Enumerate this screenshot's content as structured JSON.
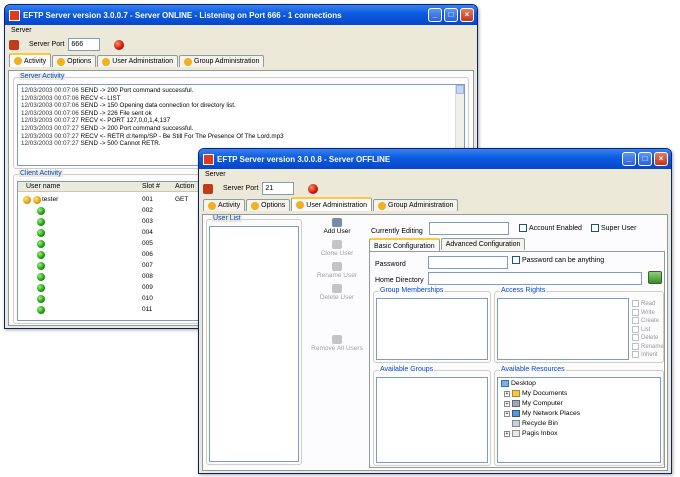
{
  "win1": {
    "title": "EFTP Server version 3.0.0.7 - Server ONLINE - Listening on Port 666 - 1 connections",
    "menu": "Server",
    "port_label": "Server Port",
    "port_value": "666",
    "tabs": [
      "Activity",
      "Options",
      "User Administration",
      "Group Administration"
    ],
    "server_activity_label": "Server Activity",
    "log": [
      {
        "ts": "12/03/2003 00:07:06",
        "msg": "SEND -> 200 Port command successful."
      },
      {
        "ts": "12/03/2003 00:07:06",
        "msg": "RECV <- LIST"
      },
      {
        "ts": "12/03/2003 00:07:06",
        "msg": "SEND -> 150 Opening data connection for directory list."
      },
      {
        "ts": "12/03/2003 00:07:06",
        "msg": "SEND -> 226 File sent ok"
      },
      {
        "ts": "12/03/2003 00:07:27",
        "msg": "RECV <- PORT 127,0,0,1,4,137"
      },
      {
        "ts": "12/03/2003 00:07:27",
        "msg": "SEND -> 200 Port command successful."
      },
      {
        "ts": "12/03/2003 00:07:27",
        "msg": "RECV <- RETR d:/temp/SP - Be Still For The Presence Of The Lord.mp3"
      },
      {
        "ts": "12/03/2003 00:07:27",
        "msg": "SEND -> 500 Cannot RETR."
      }
    ],
    "client_activity_label": "Client Activity",
    "columns": [
      "User name",
      "Slot #",
      "Action"
    ],
    "rows": [
      {
        "user": "tester",
        "slot": "001",
        "action": "GET"
      },
      {
        "user": "",
        "slot": "002",
        "action": ""
      },
      {
        "user": "",
        "slot": "003",
        "action": ""
      },
      {
        "user": "",
        "slot": "004",
        "action": ""
      },
      {
        "user": "",
        "slot": "005",
        "action": ""
      },
      {
        "user": "",
        "slot": "006",
        "action": ""
      },
      {
        "user": "",
        "slot": "007",
        "action": ""
      },
      {
        "user": "",
        "slot": "008",
        "action": ""
      },
      {
        "user": "",
        "slot": "009",
        "action": ""
      },
      {
        "user": "",
        "slot": "010",
        "action": ""
      },
      {
        "user": "",
        "slot": "011",
        "action": ""
      }
    ]
  },
  "win2": {
    "title": "EFTP Server version 3.0.0.8 - Server OFFLINE",
    "menu": "Server",
    "port_label": "Server Port",
    "port_value": "21",
    "tabs": [
      "Activity",
      "Options",
      "User Administration",
      "Group Administration"
    ],
    "user_list_label": "User List",
    "side_buttons": [
      {
        "label": "Add User",
        "enabled": true
      },
      {
        "label": "Clone User",
        "enabled": false
      },
      {
        "label": "Rename User",
        "enabled": false
      },
      {
        "label": "Delete User",
        "enabled": false
      },
      {
        "label": "Remove All Users",
        "enabled": false
      }
    ],
    "currently_editing_label": "Currently Editing",
    "account_enabled_label": "Account Enabled",
    "super_user_label": "Super User",
    "subtabs": [
      "Basic Configuration",
      "Advanced Configuration"
    ],
    "password_label": "Password",
    "password_anything_label": "Password can be anything",
    "home_dir_label": "Home Directory",
    "group_memberships_label": "Group Memberships",
    "access_rights_label": "Access Rights",
    "rights": [
      "Read",
      "Write",
      "Create",
      "List",
      "Delete",
      "Rename",
      "Inherit"
    ],
    "available_groups_label": "Available Groups",
    "available_resources_label": "Available Resources",
    "resources": [
      "Desktop",
      "My Documents",
      "My Computer",
      "My Network Places",
      "Recycle Bin",
      "Pagis Inbox"
    ]
  }
}
